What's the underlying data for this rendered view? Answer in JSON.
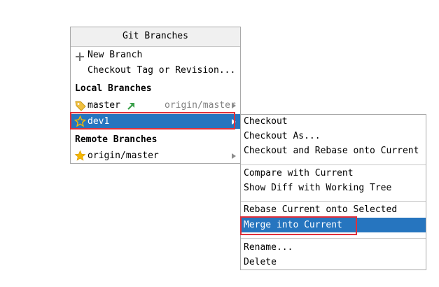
{
  "popup": {
    "title": "Git Branches",
    "actions": [
      {
        "label": "New Branch",
        "icon": "plus-icon"
      },
      {
        "label": "Checkout Tag or Revision...",
        "icon": ""
      }
    ],
    "local_header": "Local Branches",
    "local_branches": [
      {
        "name": "master",
        "tracking": "origin/master",
        "icon": "tag-icon",
        "badge_icon": "outgoing-arrow-icon",
        "selected": false
      },
      {
        "name": "dev1",
        "tracking": "",
        "icon": "star-outline-icon",
        "selected": true
      }
    ],
    "remote_header": "Remote Branches",
    "remote_branches": [
      {
        "name": "origin/master",
        "icon": "star-filled-icon"
      }
    ]
  },
  "submenu": {
    "groups": [
      [
        "Checkout",
        "Checkout As...",
        "Checkout and Rebase onto Current"
      ],
      [
        "Compare with Current",
        "Show Diff with Working Tree"
      ],
      [
        "Rebase Current onto Selected",
        "Merge into Current"
      ],
      [
        "Rename...",
        "Delete"
      ]
    ],
    "highlighted": "Merge into Current"
  },
  "colors": {
    "selection": "#2675bf",
    "highlight_box": "#e0303a",
    "star": "#f5b800",
    "tag": "#f0c040",
    "arrow": "#3aa04a",
    "muted": "#808080"
  }
}
